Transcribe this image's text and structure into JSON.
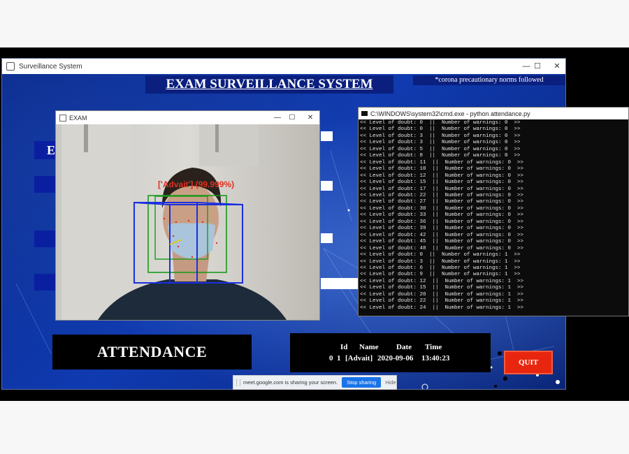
{
  "main_window": {
    "title": "Surveillance System",
    "minimize": "—",
    "maximize": "☐",
    "close": "✕"
  },
  "app": {
    "banner_title": "EXAM SURVEILLANCE SYSTEM",
    "corona_note": "*corona precautionary norms followed",
    "left_partial_letter": "E",
    "attendance_label": "ATTENDANCE",
    "quit_label": "QUIT"
  },
  "attendance_record": {
    "headers": [
      "Id",
      "Name",
      "Date",
      "Time"
    ],
    "row_index": "0",
    "row": [
      "1",
      "[Advait]",
      "2020-09-06",
      "13:40:23"
    ]
  },
  "camera_window": {
    "title": "EXAM",
    "minimize": "—",
    "maximize": "☐",
    "close": "✕",
    "detection_label": "['Advait'] (99.999%)",
    "colors": {
      "face_box": "#1a9a1a",
      "head_cube": "#1b2fe0",
      "label": "#e0301e"
    }
  },
  "cmd_window": {
    "title": "C:\\WINDOWS\\system32\\cmd.exe - python attendance.py",
    "lines": [
      "<< Level of doubt: 0  ||  Number of warnings: 0  >>",
      "<< Level of doubt: 0  ||  Number of warnings: 0  >>",
      "<< Level of doubt: 3  ||  Number of warnings: 0  >>",
      "<< Level of doubt: 3  ||  Number of warnings: 0  >>",
      "<< Level of doubt: 5  ||  Number of warnings: 0  >>",
      "<< Level of doubt: 8  ||  Number of warnings: 0  >>",
      "<< Level of doubt: 11  ||  Number of warnings: 0  >>",
      "<< Level of doubt: 10  ||  Number of warnings: 0  >>",
      "<< Level of doubt: 12  ||  Number of warnings: 0  >>",
      "<< Level of doubt: 15  ||  Number of warnings: 0  >>",
      "<< Level of doubt: 17  ||  Number of warnings: 0  >>",
      "<< Level of doubt: 22  ||  Number of warnings: 0  >>",
      "<< Level of doubt: 27  ||  Number of warnings: 0  >>",
      "<< Level of doubt: 30  ||  Number of warnings: 0  >>",
      "<< Level of doubt: 33  ||  Number of warnings: 0  >>",
      "<< Level of doubt: 36  ||  Number of warnings: 0  >>",
      "<< Level of doubt: 39  ||  Number of warnings: 0  >>",
      "<< Level of doubt: 42  ||  Number of warnings: 0  >>",
      "<< Level of doubt: 45  ||  Number of warnings: 0  >>",
      "<< Level of doubt: 48  ||  Number of warnings: 0  >>",
      "<< Level of doubt: 0  ||  Number of warnings: 1  >>",
      "<< Level of doubt: 3  ||  Number of warnings: 1  >>",
      "<< Level of doubt: 6  ||  Number of warnings: 1  >>",
      "<< Level of doubt: 9  ||  Number of warnings: 1  >>",
      "<< Level of doubt: 12  ||  Number of warnings: 1  >>",
      "<< Level of doubt: 15  ||  Number of warnings: 1  >>",
      "<< Level of doubt: 20  ||  Number of warnings: 1  >>",
      "<< Level of doubt: 22  ||  Number of warnings: 1  >>",
      "<< Level of doubt: 24  ||  Number of warnings: 1  >>"
    ]
  },
  "share_bar": {
    "message": "meet.google.com is sharing your screen.",
    "stop_label": "Stop sharing",
    "hide_label": "Hide"
  }
}
